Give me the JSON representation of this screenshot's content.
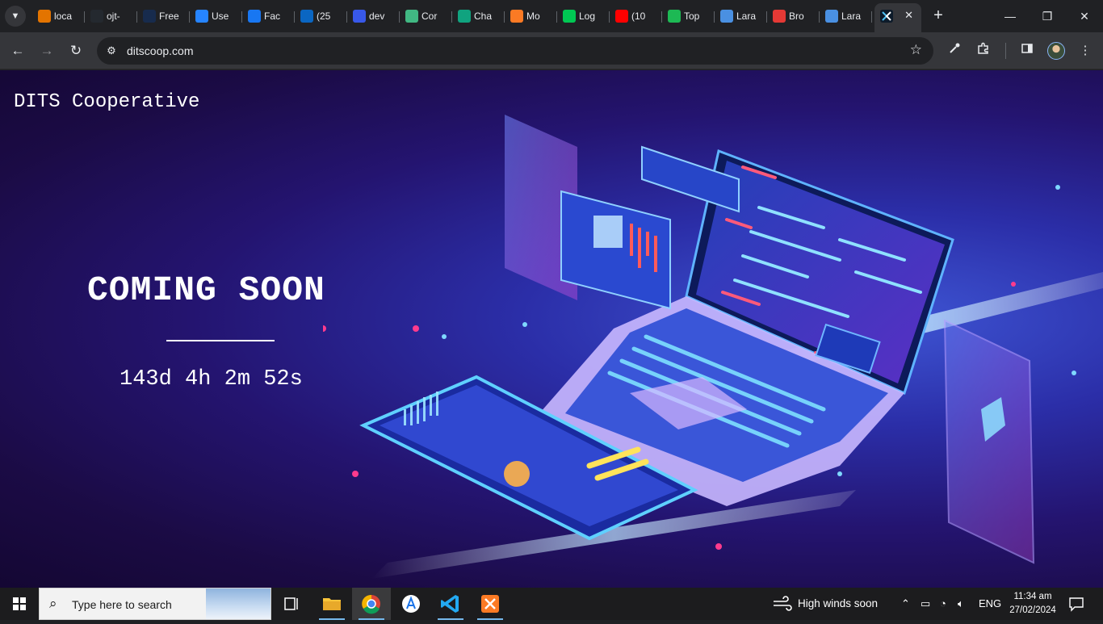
{
  "browser": {
    "tabs": [
      {
        "label": "loca",
        "color": "#e37400",
        "icon": "fire-icon"
      },
      {
        "label": "ojt-",
        "color": "#24292f",
        "icon": "github-icon"
      },
      {
        "label": "Free",
        "color": "#172b4d",
        "icon": "mp-icon"
      },
      {
        "label": "Use",
        "color": "#2684ff",
        "icon": "flag-icon"
      },
      {
        "label": "Fac",
        "color": "#1877f2",
        "icon": "facebook-icon"
      },
      {
        "label": "(25",
        "color": "#0a66c2",
        "icon": "linkedin-icon"
      },
      {
        "label": "dev",
        "color": "#3858e9",
        "icon": "wordpress-icon"
      },
      {
        "label": "Cor",
        "color": "#41b883",
        "icon": "vue-icon"
      },
      {
        "label": "Cha",
        "color": "#10a37f",
        "icon": "chatgpt-icon"
      },
      {
        "label": "Mo",
        "color": "#fb7a24",
        "icon": "xampp-icon"
      },
      {
        "label": "Log",
        "color": "#00c853",
        "icon": "leaf-icon"
      },
      {
        "label": "(10",
        "color": "#ff0000",
        "icon": "youtube-icon"
      },
      {
        "label": "Top",
        "color": "#1db954",
        "icon": "timer-icon"
      },
      {
        "label": "Lara",
        "color": "#4a90e2",
        "icon": "globe-icon"
      },
      {
        "label": "Bro",
        "color": "#e53935",
        "icon": "laravel-icon"
      },
      {
        "label": "Lara",
        "color": "#4a90e2",
        "icon": "globe-icon"
      }
    ],
    "active_tab": {
      "icon": "ditscoop-icon",
      "close": "✕"
    },
    "new_tab": "+",
    "window": {
      "minimize": "—",
      "maximize": "❐",
      "close": "✕"
    },
    "url": "ditscoop.com"
  },
  "page": {
    "brand": "DITS Cooperative",
    "heading": "COMING SOON",
    "countdown": "143d 4h 2m 52s"
  },
  "taskbar": {
    "search_placeholder": "Type here to search",
    "weather": "High winds soon",
    "language": "ENG",
    "time": "11:34 am",
    "date": "27/02/2024"
  }
}
